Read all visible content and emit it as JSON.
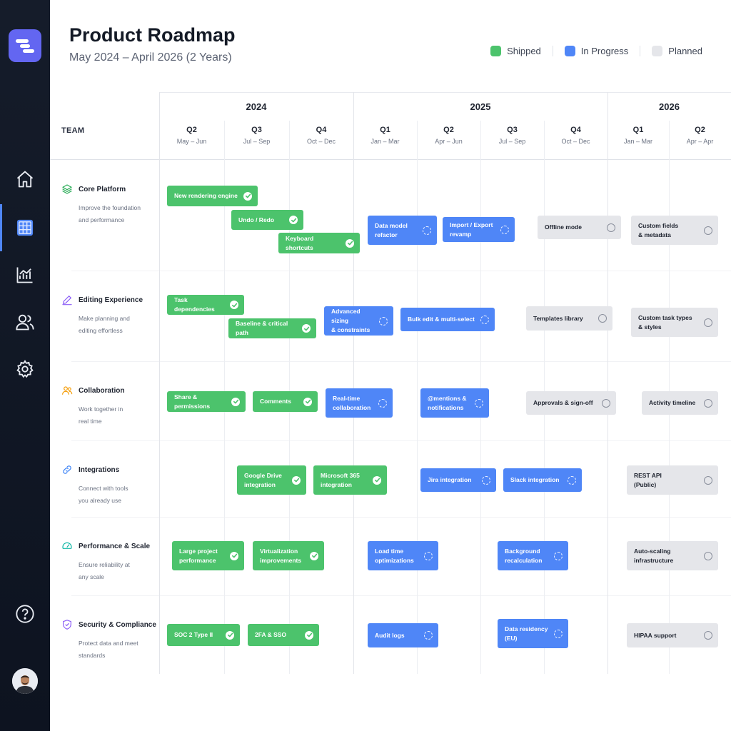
{
  "app": {
    "title": "Product Roadmap",
    "subtitle": "May 2024 – April 2026 (2 Years)"
  },
  "nav": {
    "items": [
      {
        "icon": "home-icon",
        "active": false
      },
      {
        "icon": "grid-icon",
        "active": true
      },
      {
        "icon": "chart-icon",
        "active": false
      },
      {
        "icon": "users-icon",
        "active": false
      },
      {
        "icon": "gear-icon",
        "active": false
      },
      {
        "icon": "help-icon",
        "active": false
      }
    ]
  },
  "legend": [
    {
      "label": "Shipped",
      "color": "#4cc36c"
    },
    {
      "label": "In Progress",
      "color": "#4f86f7"
    },
    {
      "label": "Planned",
      "color": "#e5e6ea"
    }
  ],
  "timeline": {
    "team_header": "TEAM",
    "years": [
      "2024",
      "2025",
      "2026"
    ],
    "quarters": [
      {
        "label": "Q2",
        "range": "May – Jun"
      },
      {
        "label": "Q3",
        "range": "Jul – Sep"
      },
      {
        "label": "Q4",
        "range": "Oct – Dec"
      },
      {
        "label": "Q1",
        "range": "Jan – Mar"
      },
      {
        "label": "Q2",
        "range": "Apr – Jun"
      },
      {
        "label": "Q3",
        "range": "Jul – Sep"
      },
      {
        "label": "Q4",
        "range": "Oct – Dec"
      },
      {
        "label": "Q1",
        "range": "Jan – Mar"
      },
      {
        "label": "Q2",
        "range": "Apr – Apr"
      }
    ]
  },
  "teams": [
    {
      "name": "Core Platform",
      "icon": "layers-icon",
      "icon_color": "#2fae5b",
      "description": "Improve the foundation\nand performance",
      "items": [
        {
          "label": "New rendering engine",
          "status": "shipped"
        },
        {
          "label": "Undo / Redo",
          "status": "shipped"
        },
        {
          "label": "Keyboard shortcuts",
          "status": "shipped"
        },
        {
          "label": "Data model\nrefactor",
          "status": "progress"
        },
        {
          "label": "Import / Export\nrevamp",
          "status": "progress"
        },
        {
          "label": "Offline mode",
          "status": "planned"
        },
        {
          "label": "Custom fields\n& metadata",
          "status": "planned"
        }
      ]
    },
    {
      "name": "Editing Experience",
      "icon": "pen-icon",
      "icon_color": "#8b5cf6",
      "description": "Make planning and\nediting effortless",
      "items": [
        {
          "label": "Task dependencies",
          "status": "shipped"
        },
        {
          "label": "Baseline & critical path",
          "status": "shipped"
        },
        {
          "label": "Advanced sizing\n& constraints",
          "status": "progress"
        },
        {
          "label": "Bulk edit & multi-select",
          "status": "progress"
        },
        {
          "label": "Templates library",
          "status": "planned"
        },
        {
          "label": "Custom task types\n& styles",
          "status": "planned"
        }
      ]
    },
    {
      "name": "Collaboration",
      "icon": "people-icon",
      "icon_color": "#f59e0b",
      "description": "Work together in\nreal time",
      "items": [
        {
          "label": "Share & permissions",
          "status": "shipped"
        },
        {
          "label": "Comments",
          "status": "shipped"
        },
        {
          "label": "Real-time\ncollaboration",
          "status": "progress"
        },
        {
          "label": "@mentions &\nnotifications",
          "status": "progress"
        },
        {
          "label": "Approvals & sign-off",
          "status": "planned"
        },
        {
          "label": "Activity timeline",
          "status": "planned"
        }
      ]
    },
    {
      "name": "Integrations",
      "icon": "link-icon",
      "icon_color": "#3b82f6",
      "description": "Connect with tools\nyou already use",
      "items": [
        {
          "label": "Google Drive\nintegration",
          "status": "shipped"
        },
        {
          "label": "Microsoft 365\nintegration",
          "status": "shipped"
        },
        {
          "label": "Jira integration",
          "status": "progress"
        },
        {
          "label": "Slack integration",
          "status": "progress"
        },
        {
          "label": "REST API\n(Public)",
          "status": "planned"
        }
      ]
    },
    {
      "name": "Performance & Scale",
      "icon": "gauge-icon",
      "icon_color": "#14b8a6",
      "description": "Ensure reliability at\nany scale",
      "items": [
        {
          "label": "Large project\nperformance",
          "status": "shipped"
        },
        {
          "label": "Virtualization\nimprovements",
          "status": "shipped"
        },
        {
          "label": "Load time\noptimizations",
          "status": "progress"
        },
        {
          "label": "Background\nrecalculation",
          "status": "progress"
        },
        {
          "label": "Auto-scaling\ninfrastructure",
          "status": "planned"
        }
      ]
    },
    {
      "name": "Security & Compliance",
      "icon": "shield-icon",
      "icon_color": "#8b5cf6",
      "description": "Protect data and meet\nstandards",
      "items": [
        {
          "label": "SOC 2 Type II",
          "status": "shipped"
        },
        {
          "label": "2FA & SSO",
          "status": "shipped"
        },
        {
          "label": "Audit logs",
          "status": "progress"
        },
        {
          "label": "Data residency\n(EU)",
          "status": "progress"
        },
        {
          "label": "HIPAA support",
          "status": "planned"
        }
      ]
    }
  ]
}
